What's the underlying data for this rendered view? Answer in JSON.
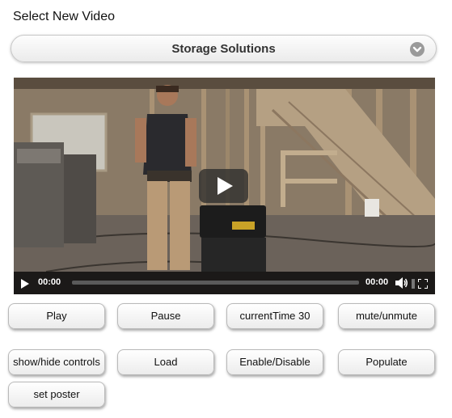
{
  "heading": "Select New Video",
  "video_select": {
    "selected": "Storage Solutions",
    "arrow_icon": "chevron-down-circle-icon"
  },
  "player": {
    "current_time": "00:00",
    "duration": "00:00",
    "progress": 0,
    "icons": {
      "big_play": "play-icon",
      "play": "play-icon",
      "volume": "speaker-icon",
      "fullscreen": "fullscreen-icon"
    }
  },
  "buttons": {
    "play": "Play",
    "pause": "Pause",
    "current_time": "currentTime 30",
    "mute": "mute/unmute",
    "controls": "show/hide controls",
    "load": "Load",
    "enable": "Enable/Disable",
    "populate": "Populate",
    "poster": "set poster"
  }
}
